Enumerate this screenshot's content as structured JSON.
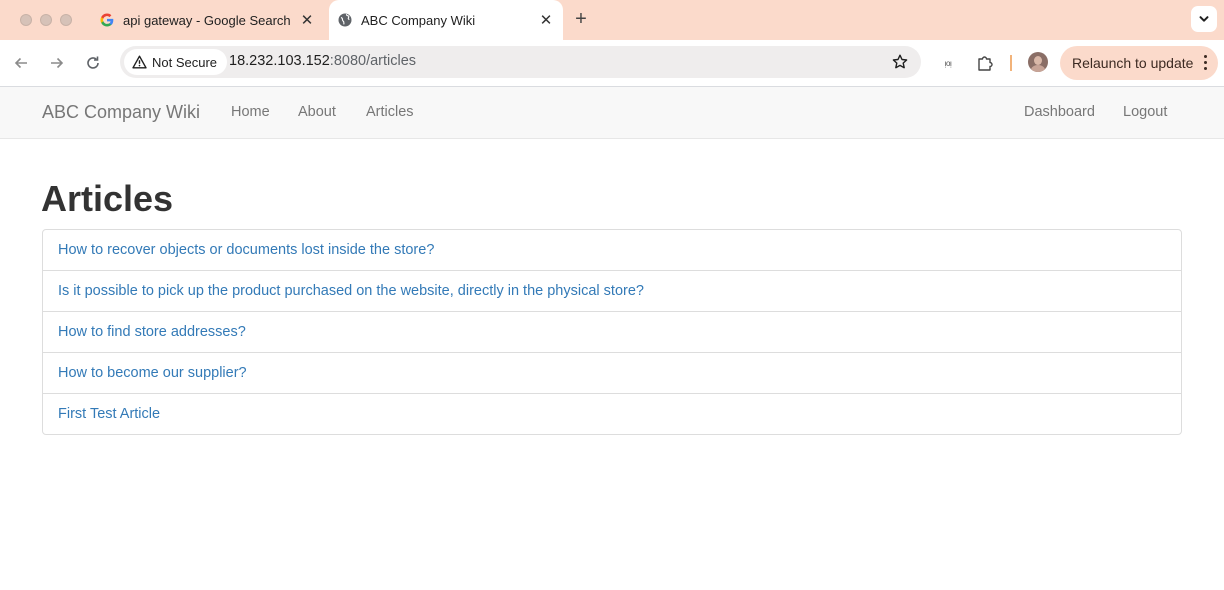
{
  "browser": {
    "tabs": [
      {
        "title": "api gateway - Google Search",
        "favicon": "google-g-icon",
        "active": false
      },
      {
        "title": "ABC Company Wiki",
        "favicon": "globe-icon",
        "active": true
      }
    ],
    "security_label": "Not Secure",
    "url_host": "18.232.103.152",
    "url_rest": ":8080/articles",
    "extension_label": "ᴉᴏᴉ",
    "relaunch_label": "Relaunch to update",
    "colors": {
      "tabbar": "#fbdacb",
      "relaunch_bg": "#fbdacb"
    }
  },
  "site": {
    "brand": "ABC Company Wiki",
    "nav_left": [
      "Home",
      "About",
      "Articles"
    ],
    "nav_right": [
      "Dashboard",
      "Logout"
    ],
    "colors": {
      "link": "#337ab7",
      "nav_text": "#777777"
    }
  },
  "main": {
    "title": "Articles",
    "articles": [
      "How to recover objects or documents lost inside the store?",
      "Is it possible to pick up the product purchased on the website, directly in the physical store?",
      "How to find store addresses?",
      "How to become our supplier?",
      "First Test Article"
    ]
  }
}
